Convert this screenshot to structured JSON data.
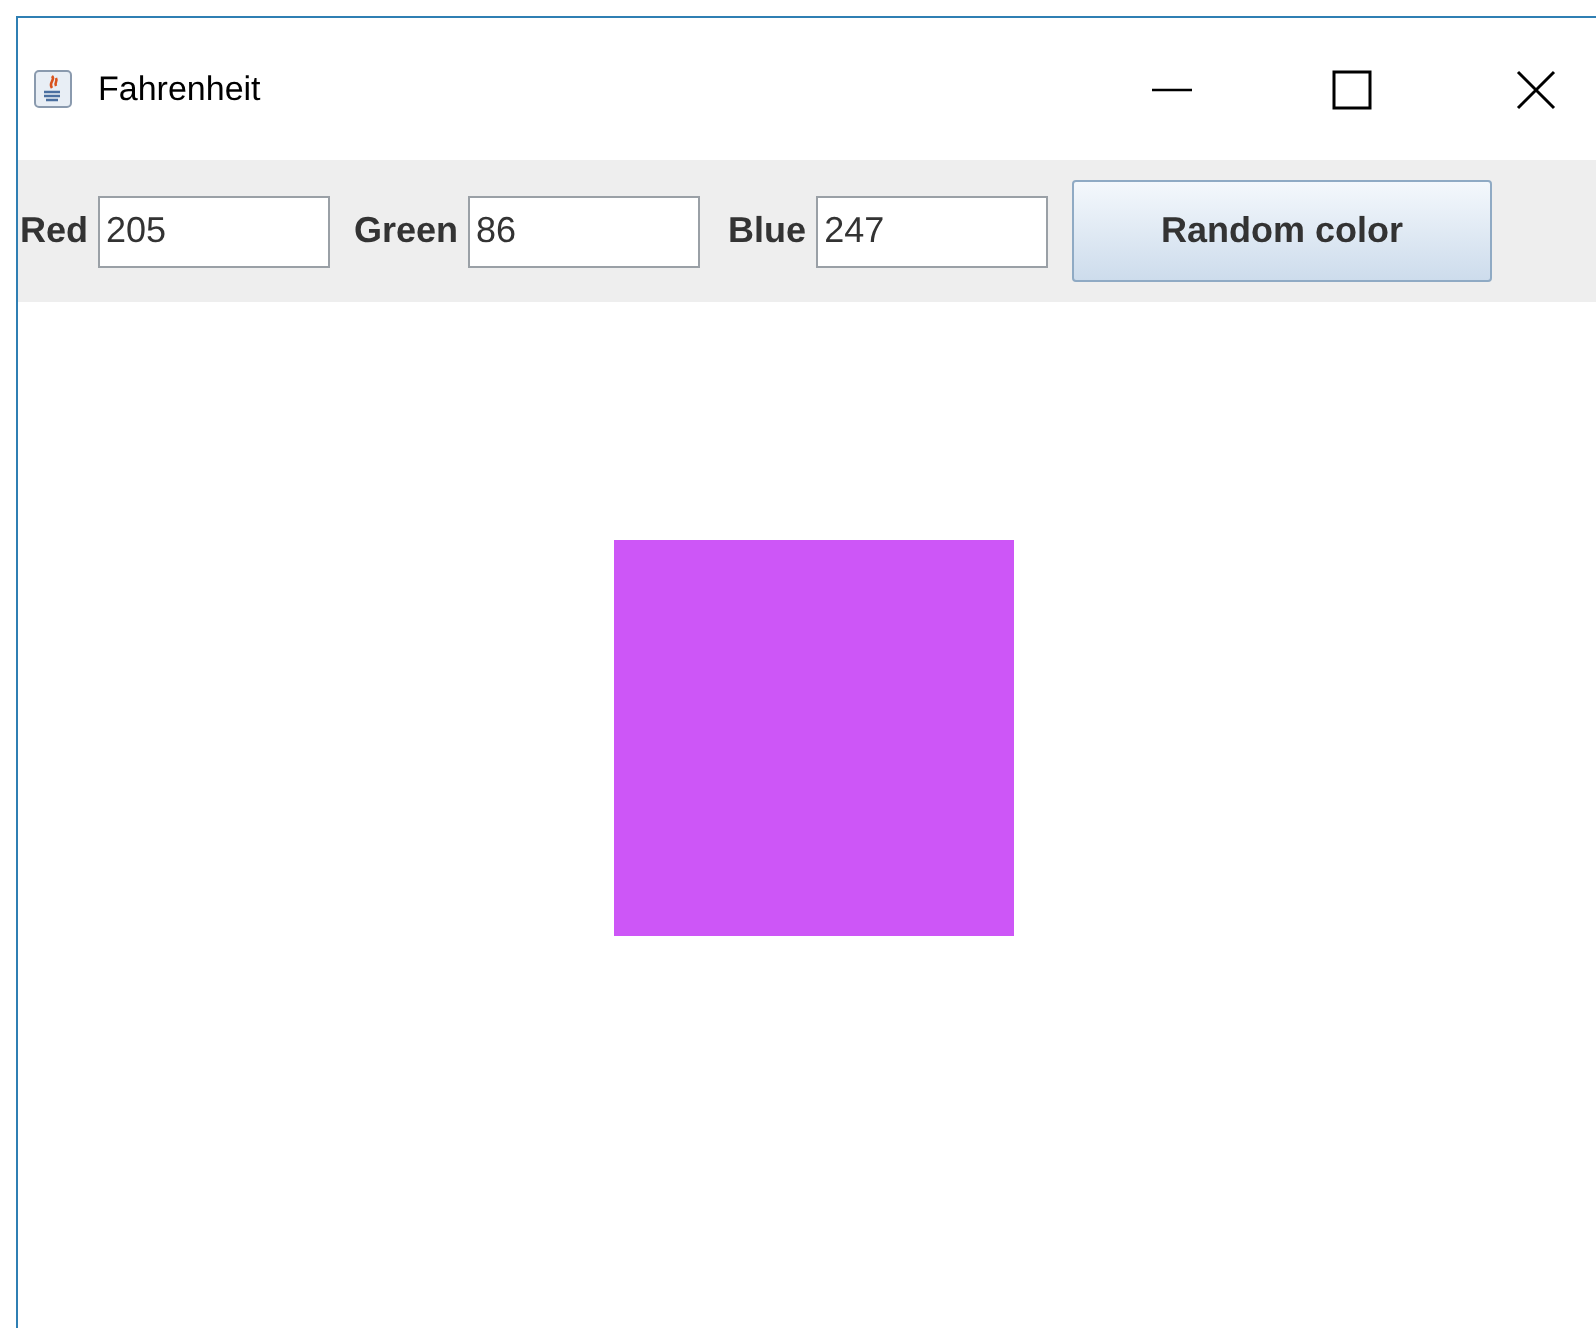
{
  "window": {
    "title": "Fahrenheit"
  },
  "toolbar": {
    "fields": [
      {
        "label": "Red",
        "value": "205"
      },
      {
        "label": "Green",
        "value": "86"
      },
      {
        "label": "Blue",
        "value": "247"
      }
    ],
    "button": "Random color"
  },
  "swatch": {
    "color": "#cd56f7"
  }
}
